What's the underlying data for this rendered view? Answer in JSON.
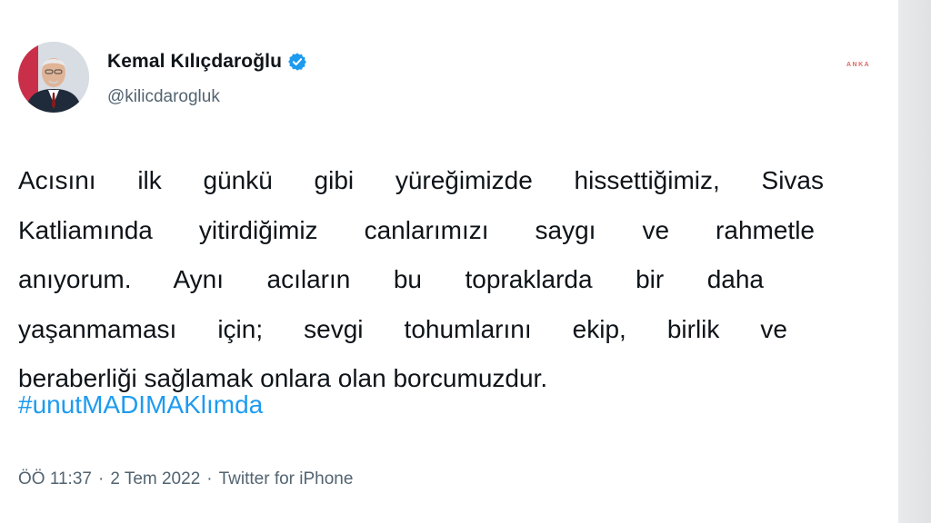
{
  "author": {
    "name": "Kemal Kılıçdaroğlu",
    "handle": "@kilicdarogluk",
    "verified": true,
    "avatar_icon": "profile-photo"
  },
  "tweet": {
    "lines": [
      "Acısını ilk günkü gibi yüreğimizde hissettiğimiz, Sivas",
      "Katliamında yitirdiğimiz canlarımızı saygı ve rahmetle",
      "anıyorum. Aynı acıların bu topraklarda bir daha",
      "yaşanmaması için; sevgi tohumlarını ekip, birlik ve",
      "beraberliği sağlamak onlara olan borcumuzdur."
    ],
    "hashtag": "#unutMADIMAKlımda"
  },
  "meta": {
    "time": "ÖÖ 11:37",
    "date": "2 Tem 2022",
    "source": "Twitter for iPhone",
    "separator": "·"
  },
  "watermark": "ANKA",
  "colors": {
    "text": "#0f1419",
    "secondary": "#536471",
    "link": "#1d9bf0",
    "verified": "#1d9bf0"
  }
}
